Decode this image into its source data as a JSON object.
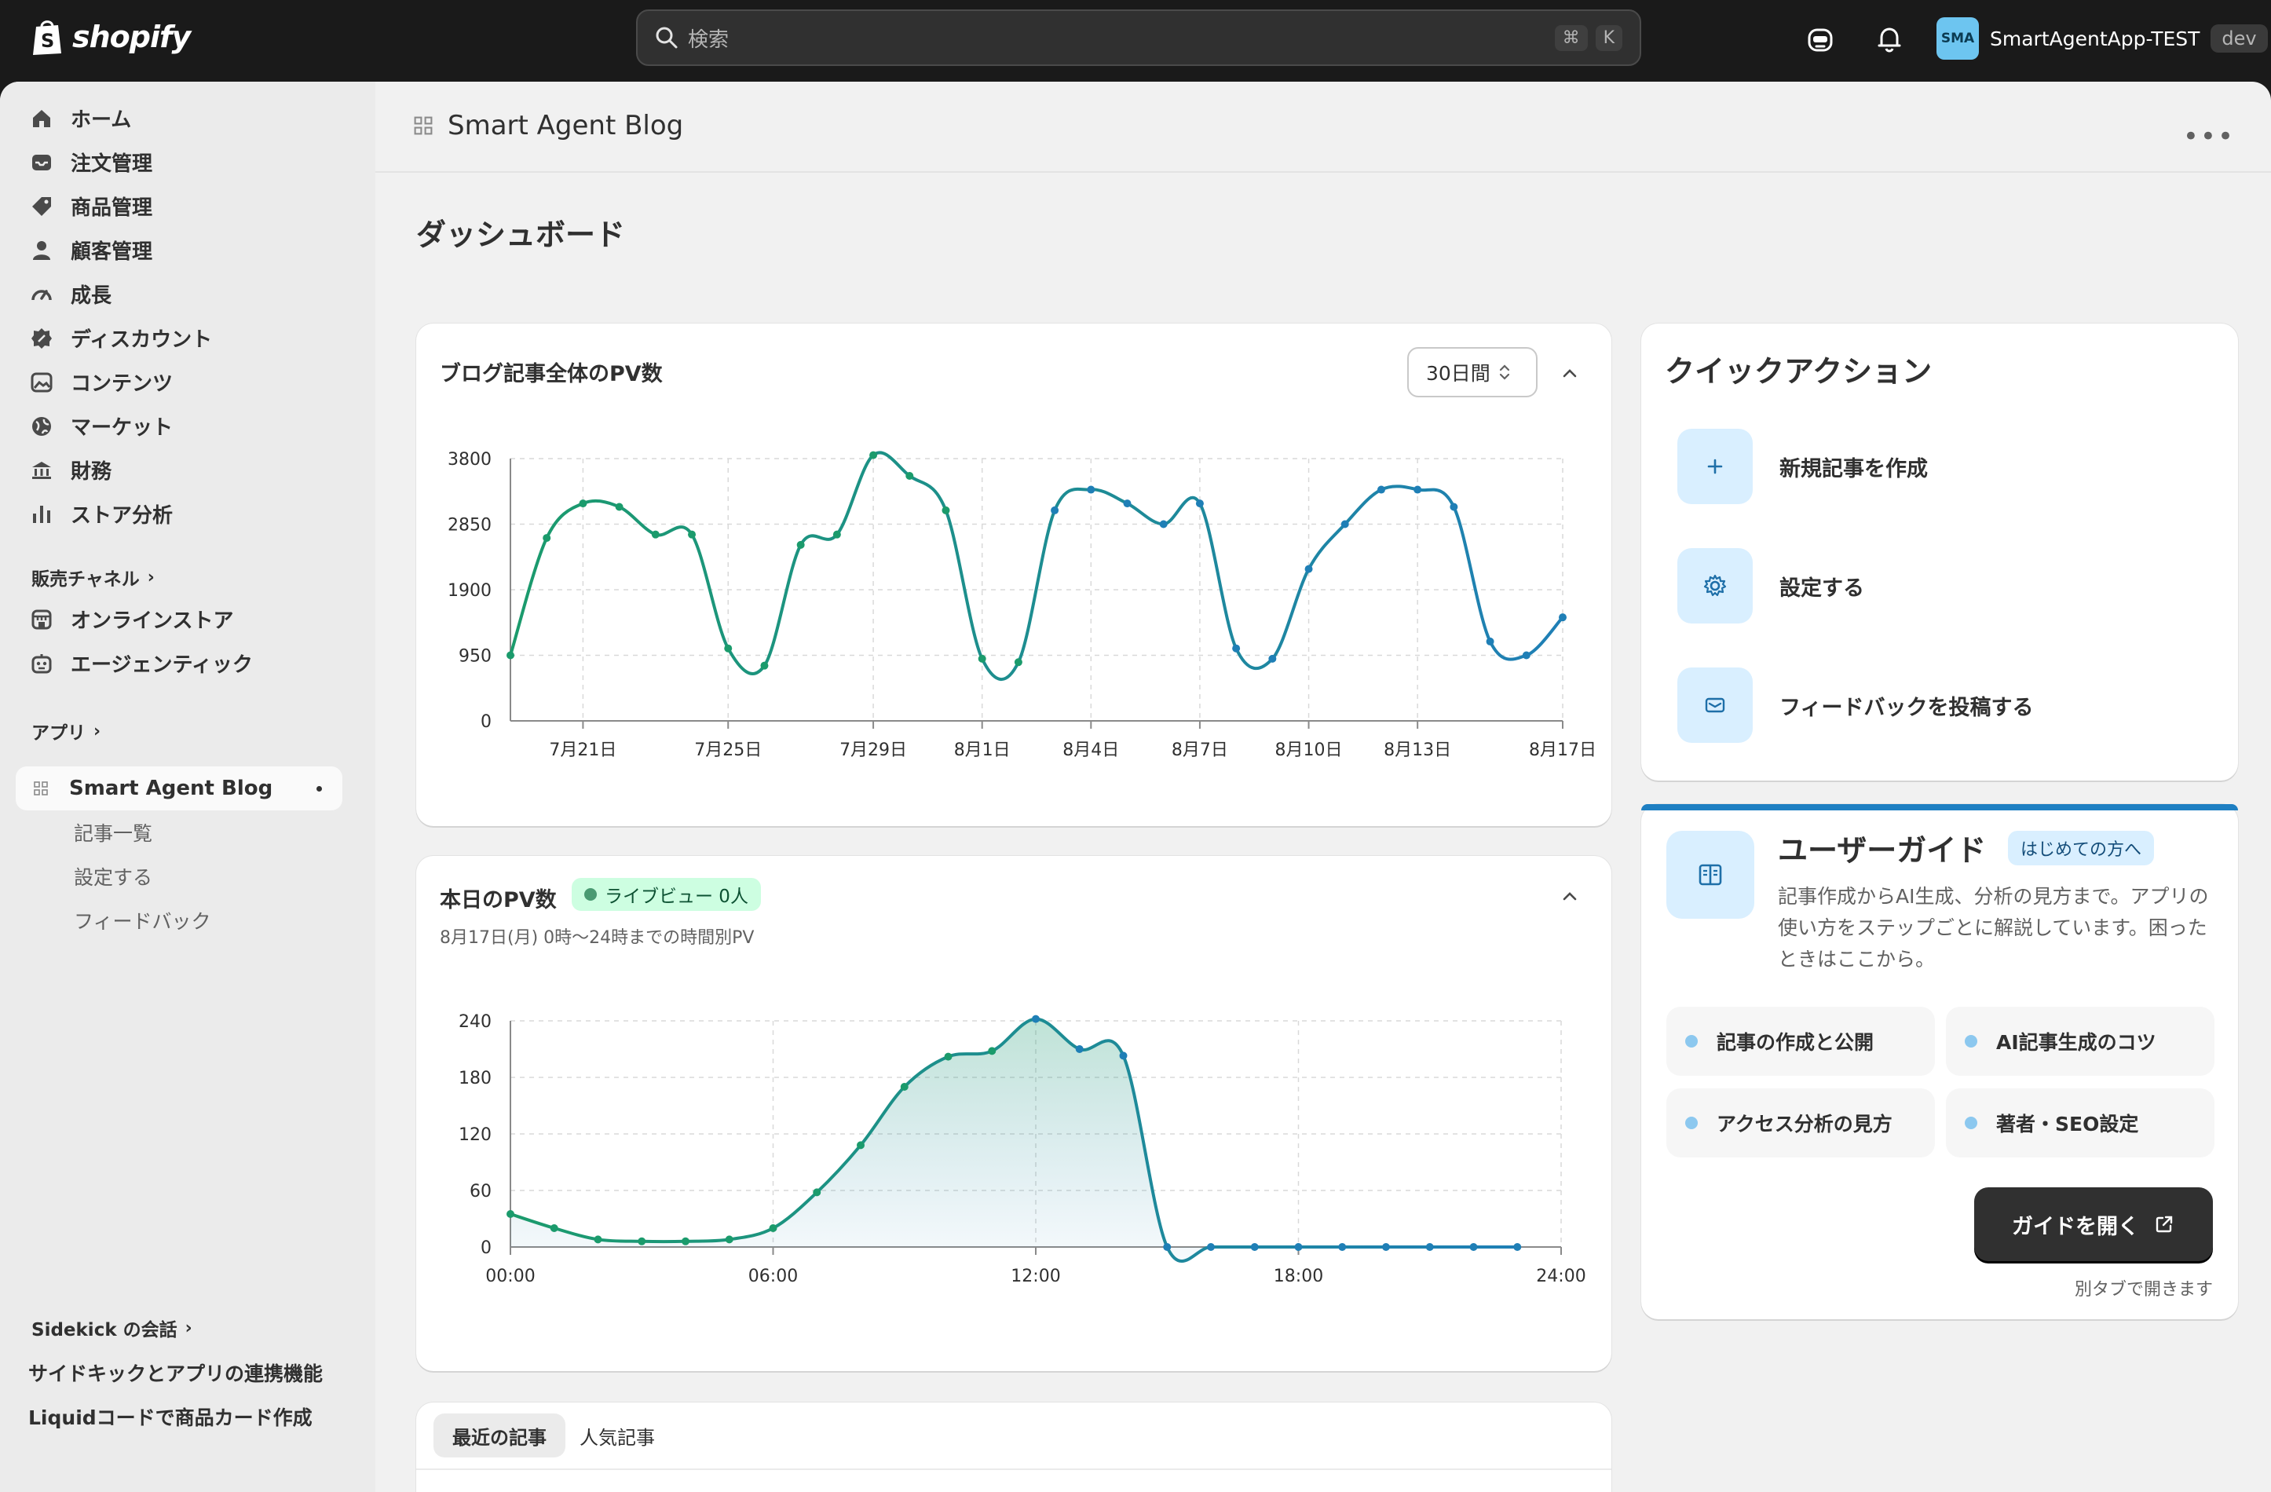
{
  "topbar": {
    "brand": "shopify",
    "search_placeholder": "検索",
    "kbd1": "⌘",
    "kbd2": "K",
    "store_initials": "SMA",
    "store_name": "SmartAgentApp-TEST",
    "env_badge": "dev"
  },
  "sidebar": {
    "items": [
      {
        "label": "ホーム",
        "icon": "home-icon"
      },
      {
        "label": "注文管理",
        "icon": "inbox-icon"
      },
      {
        "label": "商品管理",
        "icon": "tag-icon"
      },
      {
        "label": "顧客管理",
        "icon": "person-icon"
      },
      {
        "label": "成長",
        "icon": "gauge-icon"
      },
      {
        "label": "ディスカウント",
        "icon": "discount-icon"
      },
      {
        "label": "コンテンツ",
        "icon": "image-icon"
      },
      {
        "label": "マーケット",
        "icon": "globe-icon"
      },
      {
        "label": "財務",
        "icon": "bank-icon"
      },
      {
        "label": "ストア分析",
        "icon": "bar-chart-icon"
      }
    ],
    "sales_channels_label": "販売チャネル",
    "channels": [
      {
        "label": "オンラインストア",
        "icon": "store-icon"
      },
      {
        "label": "エージェンティック",
        "icon": "robot-icon"
      }
    ],
    "apps_label": "アプリ",
    "active_app": "Smart Agent Blog",
    "app_subitems": [
      "記事一覧",
      "設定する",
      "フィードバック"
    ],
    "sidekick_label": "Sidekick の会話",
    "sidekick_items": [
      "サイドキックとアプリの連携機能",
      "Liquidコードで商品カード作成"
    ]
  },
  "header": {
    "app_title": "Smart Agent Blog",
    "page_title": "ダッシュボード"
  },
  "pv_card": {
    "title": "ブログ記事全体のPV数",
    "range": "30日間"
  },
  "today_card": {
    "title": "本日のPV数",
    "live_badge": "ライブビュー 0人",
    "subtitle": "8月17日(月) 0時〜24時までの時間別PV"
  },
  "tabs": [
    "最近の記事",
    "人気記事"
  ],
  "quick_actions": {
    "title": "クイックアクション",
    "items": [
      "新規記事を作成",
      "設定する",
      "フィードバックを投稿する"
    ]
  },
  "guide": {
    "title": "ユーザーガイド",
    "badge": "はじめての方へ",
    "description": "記事作成からAI生成、分析の見方まで。アプリの使い方をステップごとに解説しています。困ったときはここから。",
    "chips": [
      "記事の作成と公開",
      "AI記事生成のコツ",
      "アクセス分析の見方",
      "著者・SEO設定"
    ],
    "button": "ガイドを開く",
    "note": "別タブで開きます"
  },
  "chart_data": [
    {
      "type": "line",
      "title": "ブログ記事全体のPV数",
      "x_ticks": [
        "7月21日",
        "7月25日",
        "7月29日",
        "8月1日",
        "8月4日",
        "8月7日",
        "8月10日",
        "8月13日",
        "8月17日"
      ],
      "y_ticks": [
        "0",
        "950",
        "1900",
        "2850",
        "3800"
      ],
      "ylim": [
        0,
        3800
      ],
      "x_dates": [
        "7/19",
        "7/20",
        "7/21",
        "7/22",
        "7/23",
        "7/24",
        "7/25",
        "7/26",
        "7/27",
        "7/28",
        "7/29",
        "7/30",
        "7/31",
        "8/1",
        "8/2",
        "8/3",
        "8/4",
        "8/5",
        "8/6",
        "8/7",
        "8/8",
        "8/9",
        "8/10",
        "8/11",
        "8/12",
        "8/13",
        "8/14",
        "8/15",
        "8/16",
        "8/17"
      ],
      "series": [
        {
          "values": [
            950,
            2650,
            3150,
            3100,
            2700,
            2700,
            1050,
            800,
            2550,
            2700,
            3850,
            3550,
            3050,
            900,
            850,
            3050,
            3350,
            3150,
            2850,
            3150,
            1050,
            900,
            2200,
            2850,
            3350,
            3350,
            3100,
            1150,
            950,
            1500
          ]
        }
      ],
      "colors": {
        "start": "#1b9b6c",
        "end": "#1f7fb6"
      },
      "grid": true
    },
    {
      "type": "area",
      "title": "本日のPV数",
      "x_ticks": [
        "00:00",
        "06:00",
        "12:00",
        "18:00",
        "24:00"
      ],
      "y_ticks": [
        "0",
        "60",
        "120",
        "180",
        "240"
      ],
      "ylim": [
        0,
        240
      ],
      "x_hours": [
        0,
        1,
        2,
        3,
        4,
        5,
        6,
        7,
        8,
        9,
        10,
        11,
        12,
        13,
        14,
        15,
        16,
        17,
        18,
        19,
        20,
        21,
        22,
        23
      ],
      "series": [
        {
          "values": [
            35,
            20,
            8,
            6,
            6,
            8,
            20,
            58,
            108,
            170,
            202,
            208,
            242,
            210,
            203,
            0,
            0,
            0,
            0,
            0,
            0,
            0,
            0,
            0
          ]
        }
      ],
      "colors": {
        "start": "#1b9b6c",
        "end": "#1f7fb6"
      },
      "grid": true
    }
  ]
}
